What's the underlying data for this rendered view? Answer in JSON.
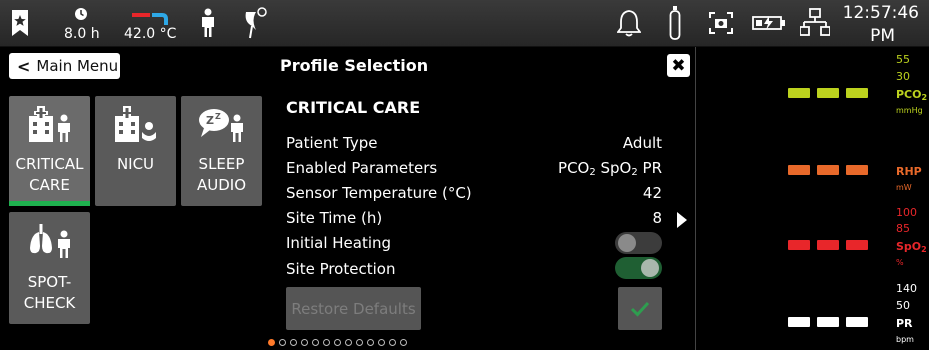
{
  "status_bar": {
    "timer_value": "8.0 h",
    "temperature_value": "42.0 °C",
    "clock_time": "12:57:46",
    "clock_ampm": "PM"
  },
  "nav": {
    "back_label": "Main Menu",
    "title": "Profile Selection",
    "close_label": "✖"
  },
  "profiles": [
    {
      "line1": "CRITICAL",
      "line2": "CARE",
      "selected": true
    },
    {
      "line1": "NICU",
      "line2": "",
      "selected": false
    },
    {
      "line1": "SLEEP",
      "line2": "AUDIO",
      "selected": false
    },
    {
      "line1": "SPOT-",
      "line2": "CHECK",
      "selected": false
    }
  ],
  "details": {
    "heading": "CRITICAL CARE",
    "patient_type": {
      "label": "Patient Type",
      "value": "Adult"
    },
    "enabled_parameters": {
      "label": "Enabled Parameters",
      "p1": "PCO",
      "p1_sub": "2",
      "p2": "SpO",
      "p2_sub": "2",
      "p3": "PR"
    },
    "sensor_temperature": {
      "label": "Sensor Temperature (°C)",
      "value": "42"
    },
    "site_time": {
      "label": "Site Time (h)",
      "value": "8"
    },
    "initial_heating": {
      "label": "Initial Heating",
      "enabled": false
    },
    "site_protection": {
      "label": "Site Protection",
      "enabled": true
    },
    "restore_label": "Restore Defaults"
  },
  "pagination": {
    "total": 13,
    "active_index": 0
  },
  "vitals": {
    "pco2": {
      "upper": "55",
      "lower": "30",
      "name": "PCO",
      "name_sub": "2",
      "unit": "mmHg",
      "color": "#bcd21e"
    },
    "rhp": {
      "name": "RHP",
      "unit": "mW",
      "color": "#e8692a"
    },
    "spo2": {
      "upper": "100",
      "lower": "85",
      "name": "SpO",
      "name_sub": "2",
      "unit": "%",
      "color": "#e8262a"
    },
    "pr": {
      "upper": "140",
      "lower": "50",
      "name": "PR",
      "unit": "bpm",
      "color": "#ffffff"
    }
  },
  "colors": {
    "accent_green": "#1fb14f",
    "page_dot_active": "#ff7a2a"
  }
}
